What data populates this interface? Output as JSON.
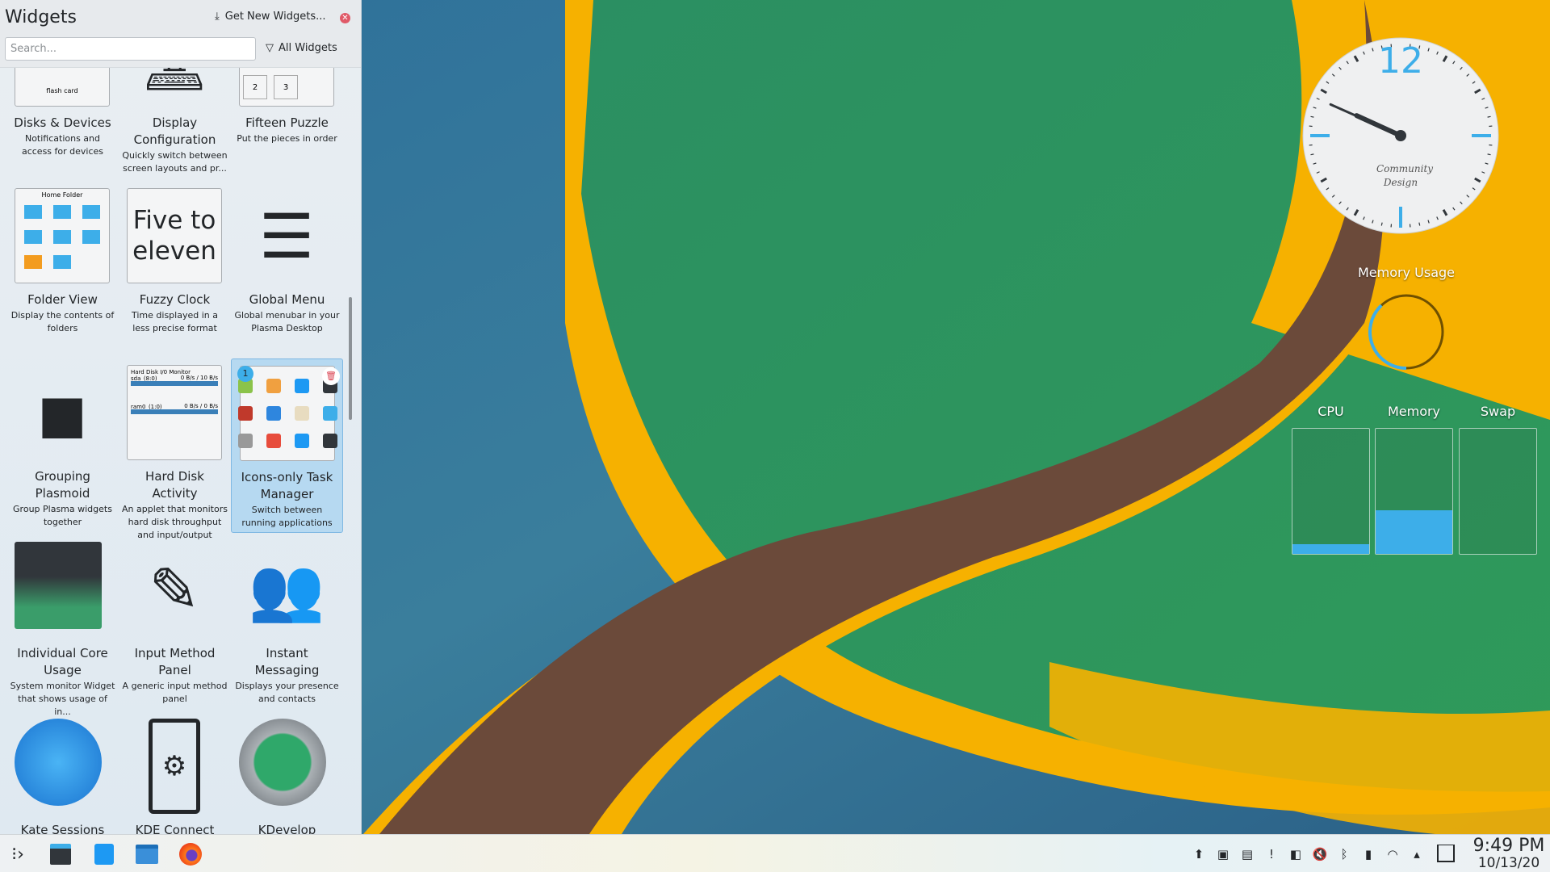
{
  "panel": {
    "title": "Widgets",
    "get_new": "Get New Widgets...",
    "search_placeholder": "Search...",
    "search_value": "",
    "filter": "All Widgets"
  },
  "widgets": [
    {
      "name": "Disks & Devices",
      "desc": "Notifications and access for devices",
      "preview": "disks",
      "preview_text": "flash card"
    },
    {
      "name": "Display Configuration",
      "desc": "Quickly switch between screen layouts and pr...",
      "preview": "display"
    },
    {
      "name": "Fifteen Puzzle",
      "desc": "Put the pieces in order",
      "preview": "puzzle",
      "preview_text": [
        "2",
        "3"
      ]
    },
    {
      "name": "Folder View",
      "desc": "Display the contents of folders",
      "preview": "folder",
      "preview_text": "Home Folder"
    },
    {
      "name": "Fuzzy Clock",
      "desc": "Time displayed in a less precise format",
      "preview": "fuzzy",
      "preview_text": "Five to eleven"
    },
    {
      "name": "Global Menu",
      "desc": "Global menubar in your Plasma Desktop",
      "preview": "menu"
    },
    {
      "name": "Grouping Plasmoid",
      "desc": "Group Plasma widgets together",
      "preview": "grouping"
    },
    {
      "name": "Hard Disk Activity",
      "desc": "An applet that monitors hard disk throughput and input/output",
      "preview": "hdd",
      "preview_text": [
        "Hard Disk I/0 Monitor",
        "sda_(8:0)",
        "0 B/s / 10 B/s",
        "ram0_(1:0)",
        "0 B/s / 0 B/s"
      ]
    },
    {
      "name": "Icons-only Task Manager",
      "desc": "Switch between running applications",
      "preview": "icontasks",
      "selected": true,
      "badge": "1"
    },
    {
      "name": "Individual Core Usage",
      "desc": "System monitor Widget that shows usage of in...",
      "preview": "core"
    },
    {
      "name": "Input Method Panel",
      "desc": "A generic input method panel",
      "preview": "input"
    },
    {
      "name": "Instant Messaging",
      "desc": "Displays your presence and contacts",
      "preview": "im"
    },
    {
      "name": "Kate Sessions",
      "desc": "",
      "preview": "kate"
    },
    {
      "name": "KDE Connect",
      "desc": "",
      "preview": "kdeconnect"
    },
    {
      "name": "KDevelop",
      "desc": "",
      "preview": "kdevelop"
    }
  ],
  "desktop": {
    "clock": {
      "numeral": "12",
      "brand": "Community Design",
      "hour": 9,
      "minute": 49
    },
    "memory_usage": {
      "title": "Memory Usage",
      "fraction": 0.38
    },
    "bars": [
      {
        "label": "CPU",
        "fraction": 0.08
      },
      {
        "label": "Memory",
        "fraction": 0.35
      },
      {
        "label": "Swap",
        "fraction": 0
      }
    ]
  },
  "taskbar": {
    "launchers": [
      "application-launcher-icon",
      "system-settings-icon",
      "discover-icon",
      "dolphin-icon",
      "firefox-icon"
    ],
    "tray": [
      "updates-icon",
      "konsole-icon",
      "clipboard-icon",
      "notifications-icon",
      "devices-icon",
      "volume-muted-icon",
      "bluetooth-icon",
      "battery-icon",
      "wifi-icon",
      "expand-tray-icon"
    ],
    "time": "9:49 PM",
    "date": "10/13/20"
  },
  "colors": {
    "accent": "#3daee9",
    "brown": "#6b4a3a",
    "yellow": "#f5b400",
    "green": "#2f9a5e"
  }
}
